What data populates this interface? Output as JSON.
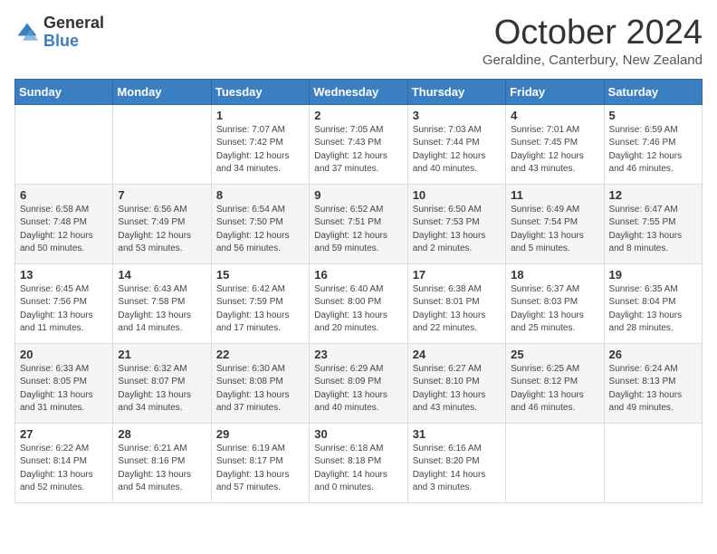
{
  "logo": {
    "general": "General",
    "blue": "Blue"
  },
  "header": {
    "month": "October 2024",
    "location": "Geraldine, Canterbury, New Zealand"
  },
  "weekdays": [
    "Sunday",
    "Monday",
    "Tuesday",
    "Wednesday",
    "Thursday",
    "Friday",
    "Saturday"
  ],
  "weeks": [
    [
      {
        "day": "",
        "info": ""
      },
      {
        "day": "",
        "info": ""
      },
      {
        "day": "1",
        "info": "Sunrise: 7:07 AM\nSunset: 7:42 PM\nDaylight: 12 hours and 34 minutes."
      },
      {
        "day": "2",
        "info": "Sunrise: 7:05 AM\nSunset: 7:43 PM\nDaylight: 12 hours and 37 minutes."
      },
      {
        "day": "3",
        "info": "Sunrise: 7:03 AM\nSunset: 7:44 PM\nDaylight: 12 hours and 40 minutes."
      },
      {
        "day": "4",
        "info": "Sunrise: 7:01 AM\nSunset: 7:45 PM\nDaylight: 12 hours and 43 minutes."
      },
      {
        "day": "5",
        "info": "Sunrise: 6:59 AM\nSunset: 7:46 PM\nDaylight: 12 hours and 46 minutes."
      }
    ],
    [
      {
        "day": "6",
        "info": "Sunrise: 6:58 AM\nSunset: 7:48 PM\nDaylight: 12 hours and 50 minutes."
      },
      {
        "day": "7",
        "info": "Sunrise: 6:56 AM\nSunset: 7:49 PM\nDaylight: 12 hours and 53 minutes."
      },
      {
        "day": "8",
        "info": "Sunrise: 6:54 AM\nSunset: 7:50 PM\nDaylight: 12 hours and 56 minutes."
      },
      {
        "day": "9",
        "info": "Sunrise: 6:52 AM\nSunset: 7:51 PM\nDaylight: 12 hours and 59 minutes."
      },
      {
        "day": "10",
        "info": "Sunrise: 6:50 AM\nSunset: 7:53 PM\nDaylight: 13 hours and 2 minutes."
      },
      {
        "day": "11",
        "info": "Sunrise: 6:49 AM\nSunset: 7:54 PM\nDaylight: 13 hours and 5 minutes."
      },
      {
        "day": "12",
        "info": "Sunrise: 6:47 AM\nSunset: 7:55 PM\nDaylight: 13 hours and 8 minutes."
      }
    ],
    [
      {
        "day": "13",
        "info": "Sunrise: 6:45 AM\nSunset: 7:56 PM\nDaylight: 13 hours and 11 minutes."
      },
      {
        "day": "14",
        "info": "Sunrise: 6:43 AM\nSunset: 7:58 PM\nDaylight: 13 hours and 14 minutes."
      },
      {
        "day": "15",
        "info": "Sunrise: 6:42 AM\nSunset: 7:59 PM\nDaylight: 13 hours and 17 minutes."
      },
      {
        "day": "16",
        "info": "Sunrise: 6:40 AM\nSunset: 8:00 PM\nDaylight: 13 hours and 20 minutes."
      },
      {
        "day": "17",
        "info": "Sunrise: 6:38 AM\nSunset: 8:01 PM\nDaylight: 13 hours and 22 minutes."
      },
      {
        "day": "18",
        "info": "Sunrise: 6:37 AM\nSunset: 8:03 PM\nDaylight: 13 hours and 25 minutes."
      },
      {
        "day": "19",
        "info": "Sunrise: 6:35 AM\nSunset: 8:04 PM\nDaylight: 13 hours and 28 minutes."
      }
    ],
    [
      {
        "day": "20",
        "info": "Sunrise: 6:33 AM\nSunset: 8:05 PM\nDaylight: 13 hours and 31 minutes."
      },
      {
        "day": "21",
        "info": "Sunrise: 6:32 AM\nSunset: 8:07 PM\nDaylight: 13 hours and 34 minutes."
      },
      {
        "day": "22",
        "info": "Sunrise: 6:30 AM\nSunset: 8:08 PM\nDaylight: 13 hours and 37 minutes."
      },
      {
        "day": "23",
        "info": "Sunrise: 6:29 AM\nSunset: 8:09 PM\nDaylight: 13 hours and 40 minutes."
      },
      {
        "day": "24",
        "info": "Sunrise: 6:27 AM\nSunset: 8:10 PM\nDaylight: 13 hours and 43 minutes."
      },
      {
        "day": "25",
        "info": "Sunrise: 6:25 AM\nSunset: 8:12 PM\nDaylight: 13 hours and 46 minutes."
      },
      {
        "day": "26",
        "info": "Sunrise: 6:24 AM\nSunset: 8:13 PM\nDaylight: 13 hours and 49 minutes."
      }
    ],
    [
      {
        "day": "27",
        "info": "Sunrise: 6:22 AM\nSunset: 8:14 PM\nDaylight: 13 hours and 52 minutes."
      },
      {
        "day": "28",
        "info": "Sunrise: 6:21 AM\nSunset: 8:16 PM\nDaylight: 13 hours and 54 minutes."
      },
      {
        "day": "29",
        "info": "Sunrise: 6:19 AM\nSunset: 8:17 PM\nDaylight: 13 hours and 57 minutes."
      },
      {
        "day": "30",
        "info": "Sunrise: 6:18 AM\nSunset: 8:18 PM\nDaylight: 14 hours and 0 minutes."
      },
      {
        "day": "31",
        "info": "Sunrise: 6:16 AM\nSunset: 8:20 PM\nDaylight: 14 hours and 3 minutes."
      },
      {
        "day": "",
        "info": ""
      },
      {
        "day": "",
        "info": ""
      }
    ]
  ]
}
